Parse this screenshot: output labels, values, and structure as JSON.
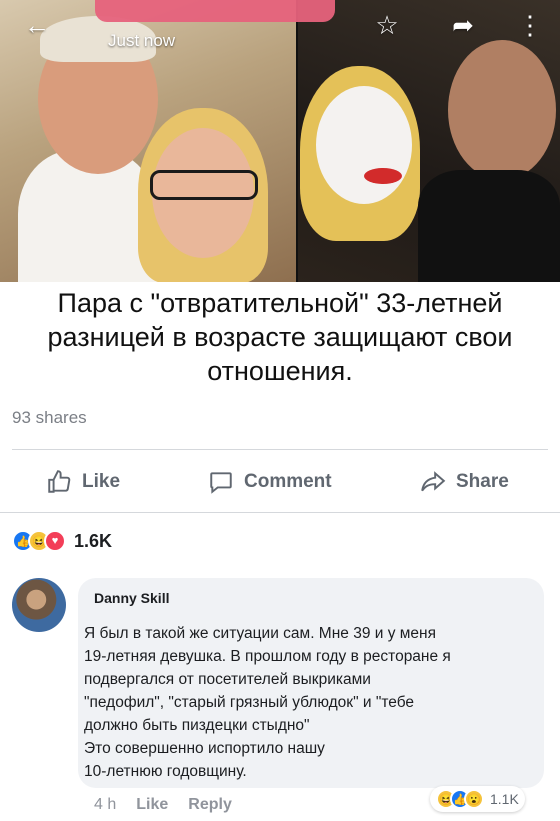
{
  "topbar": {
    "status": "Just now",
    "back_icon": "arrow-left-icon",
    "bookmark_icon": "star-outline-icon",
    "share_icon": "share-arrow-icon",
    "more_icon": "vertical-dots-icon"
  },
  "post": {
    "caption": "Пара с \"отвратительной\" 33-летней разницей в возрасте защищают свои отношения.",
    "shares": "93 shares"
  },
  "actions": {
    "like": "Like",
    "comment": "Comment",
    "share": "Share"
  },
  "reactions": {
    "types": [
      "like",
      "haha",
      "love"
    ],
    "count": "1.6K"
  },
  "comment": {
    "author": "Danny Skill",
    "lines": [
      "Я был в такой же ситуации сам. Мне 39 и у меня",
      "19-летняя девушка. В прошлом году в ресторане я",
      "подвергался от посетителей выкриками",
      "\"педофил\", \"старый грязный ублюдок\" и \"тебе",
      "должно быть пиздецки стыдно\"",
      "Это совершенно испортило нашу",
      "10-летнюю годовщину."
    ],
    "time": "4 h",
    "like": "Like",
    "reply": "Reply",
    "reaction_types": [
      "haha",
      "like",
      "wow"
    ],
    "reaction_count": "1.1K"
  },
  "colors": {
    "accent": "#1877f2",
    "text_secondary": "#606770",
    "bubble": "#f0f2f5"
  }
}
